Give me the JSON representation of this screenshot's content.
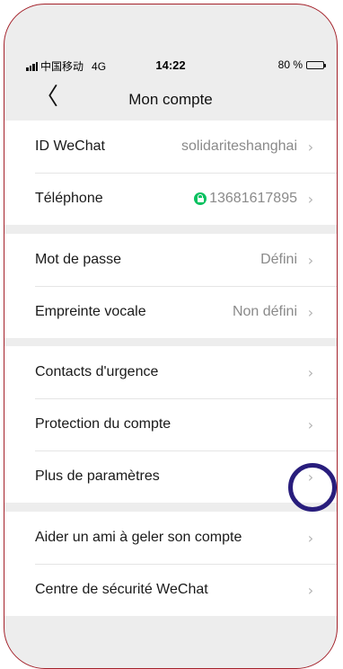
{
  "status_bar": {
    "carrier": "中国移动",
    "network": "4G",
    "time": "14:22",
    "battery": "80 %",
    "battery_level": 0.8
  },
  "nav": {
    "back_icon": "chevron-left-icon",
    "back_glyph": "〈",
    "title": "Mon compte"
  },
  "group1": [
    {
      "label": "ID WeChat",
      "value": "solidariteshanghai"
    },
    {
      "label": "Téléphone",
      "value": "13681617895"
    }
  ],
  "group2": [
    {
      "label": "Mot de passe",
      "value": "Défini"
    },
    {
      "label": "Empreinte vocale",
      "value": "Non défini"
    }
  ],
  "group3": [
    {
      "label": "Contacts d'urgence"
    },
    {
      "label": "Protection du compte"
    },
    {
      "label": "Plus de paramètres"
    }
  ],
  "group4": [
    {
      "label": "Aider un ami à geler son compte"
    },
    {
      "label": "Centre de sécurité WeChat"
    }
  ],
  "chevron_glyph": "›",
  "colors": {
    "frame_border": "#a4212a",
    "highlight_circle": "#281d7c",
    "lock_green": "#07c160",
    "background": "#ededed"
  }
}
